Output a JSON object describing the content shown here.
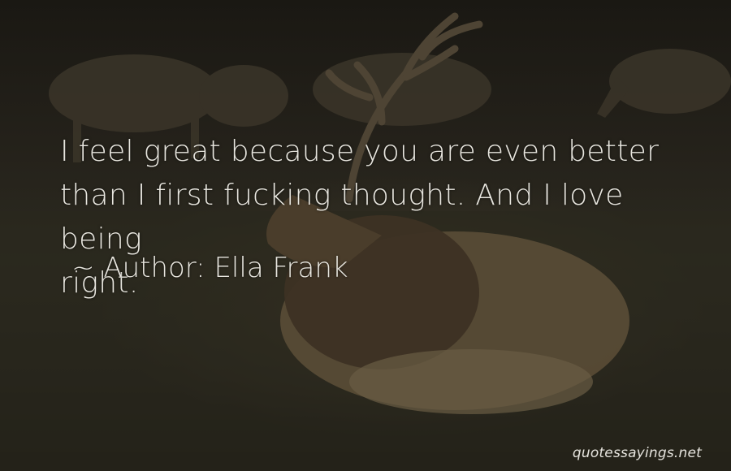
{
  "quote": {
    "lines": [
      "I feel great because you are even better",
      "than I first fucking thought. And I love being",
      "right."
    ]
  },
  "author": {
    "prefix": "~",
    "label": "Author:",
    "name": "Ella Frank"
  },
  "watermark": "quotessayings.net",
  "colors": {
    "text": "#e8e6df",
    "background": "#24211a"
  }
}
